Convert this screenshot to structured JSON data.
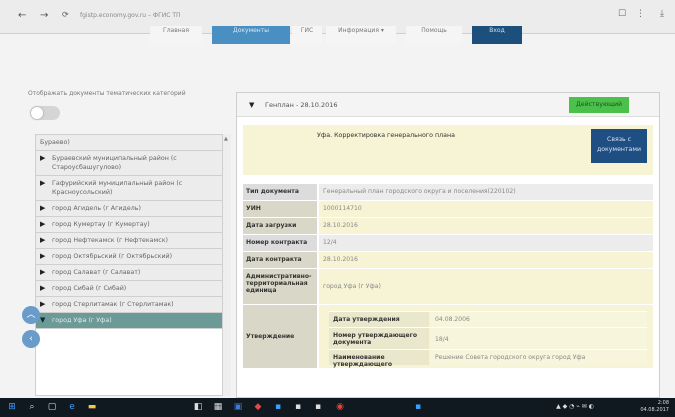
{
  "browser": {
    "back": "←",
    "forward": "→",
    "url": "fgistp.economy.gov.ru – ФГИС ТП",
    "menu_dots": "⋮"
  },
  "site_nav": {
    "tabs": [
      "Главная",
      "Документы",
      "ГИС",
      "Информация ▾",
      "Помощь",
      "Вход"
    ]
  },
  "left_panel": {
    "caption": "Отображать документы тематических категорий",
    "tree_items": [
      {
        "label": "Бураево)",
        "arrow": false
      },
      {
        "label": "Бураевский муниципальный район (с Староусбашугулово)",
        "arrow": true
      },
      {
        "label": "Гафурийский муниципальный район (с Красноусольский)",
        "arrow": true
      },
      {
        "label": "город Агидель (г Агидель)",
        "arrow": true
      },
      {
        "label": "город Кумертау (г Кумертау)",
        "arrow": true
      },
      {
        "label": "город Нефтекамск (г Нефтекамск)",
        "arrow": true
      },
      {
        "label": "город Октябрьский (г Октябрьский)",
        "arrow": true
      },
      {
        "label": "город Салават (г Салават)",
        "arrow": true
      },
      {
        "label": "город Сибай (г Сибай)",
        "arrow": true
      },
      {
        "label": "город Стерлитамак (г Стерлитамак)",
        "arrow": true
      },
      {
        "label": "город Уфа (г Уфа)",
        "arrow": true,
        "selected": true
      }
    ]
  },
  "card": {
    "header_title": "Генплан - 28.10.2016",
    "status": "Действующий",
    "doc_name": "Уфа. Корректировка генерального плана",
    "link_button": "Связь с документами",
    "rows": [
      {
        "label": "Тип документа",
        "value": "Генеральный план городского округа и поселения(220102)",
        "grey": true
      },
      {
        "label": "УИН",
        "value": "1000114710",
        "grey": false
      },
      {
        "label": "Дата загрузки",
        "value": "28.10.2016",
        "grey": false
      },
      {
        "label": "Номер контракта",
        "value": "12/4",
        "grey": true
      },
      {
        "label": "Дата контракта",
        "value": "28.10.2016",
        "grey": false
      },
      {
        "label": "Административно-территориальная единица",
        "value": "город Уфа (г Уфа)",
        "grey": false
      }
    ],
    "approval": {
      "label": "Утверждение",
      "rows": [
        {
          "label": "Дата утверждения",
          "value": "04.08.2006"
        },
        {
          "label": "Номер утверждающего документа",
          "value": "18/4"
        },
        {
          "label": "Наименование утверждающего",
          "value": "Решение Совета городского округа город Уфа"
        }
      ]
    }
  },
  "taskbar": {
    "time": "2:08",
    "date": "04.08.2017"
  }
}
